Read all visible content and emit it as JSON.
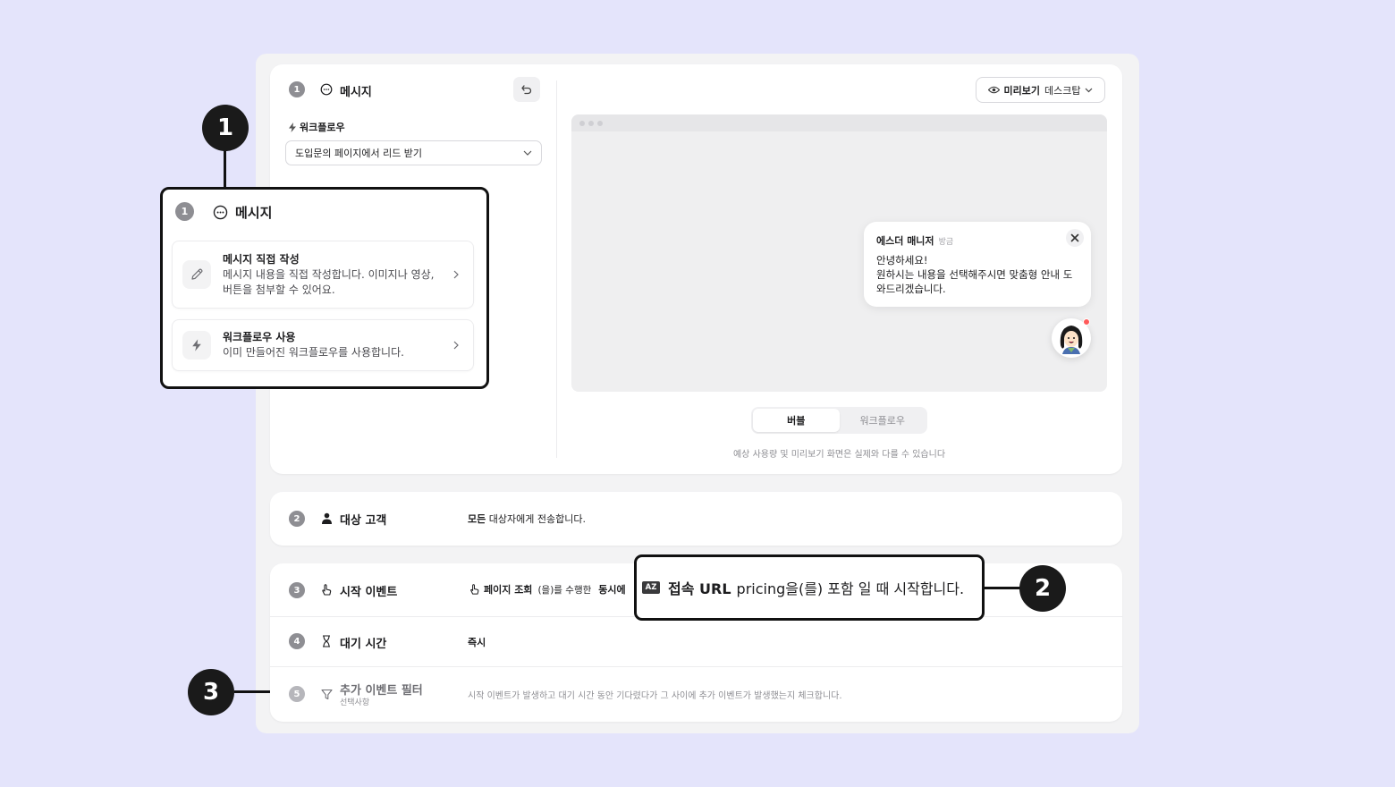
{
  "colors": {
    "background": "#e4e4fb",
    "badge": "#1a1a1a",
    "accent_dot": "#ff5a5a"
  },
  "section1": {
    "num": "1",
    "title": "메시지",
    "workflow_label": "워크플로우",
    "workflow_value": "도입문의 페이지에서 리드 받기"
  },
  "preview": {
    "label": "미리보기",
    "mode": "데스크탑",
    "chat": {
      "name": "에스더 매니저",
      "time": "방금",
      "line1": "안녕하세요!",
      "line2": "원하시는 내용을 선택해주시면 맞춤형 안내 도와드리겠습니다."
    },
    "tabs": [
      "버블",
      "워크플로우"
    ],
    "note": "예상 사용량 및 미리보기 화면은 실제와 다를 수 있습니다"
  },
  "section2": {
    "num": "2",
    "title": "대상 고객",
    "desc_bold": "모든",
    "desc": "대상자에게 전송합니다."
  },
  "section3": {
    "num": "3",
    "title": "시작 이벤트",
    "event": "페이지 조회",
    "event_suffix": "(을)를 수행한",
    "and": "동시에"
  },
  "section4": {
    "num": "4",
    "title": "대기 시간",
    "value": "즉시"
  },
  "section5": {
    "num": "5",
    "title": "추가 이벤트 필터",
    "subtitle": "선택사항",
    "desc": "시작 이벤트가 발생하고 대기 시간 동안 기다렸다가 그 사이에 추가 이벤트가 발생했는지 체크합니다."
  },
  "callout1": {
    "num": "1",
    "title": "메시지",
    "options": [
      {
        "title": "메시지 직접 작성",
        "desc": "메시지 내용을 직접 작성합니다. 이미지나 영상, 버튼을 첨부할 수 있어요."
      },
      {
        "title": "워크플로우 사용",
        "desc": "이미 만들어진 워크플로우를 사용합니다."
      }
    ]
  },
  "callout2": {
    "icon_text": "AZ",
    "bold": "접속 URL",
    "text": "pricing을(를) 포함 일 때 시작합니다."
  },
  "badges": [
    "1",
    "2",
    "3"
  ]
}
